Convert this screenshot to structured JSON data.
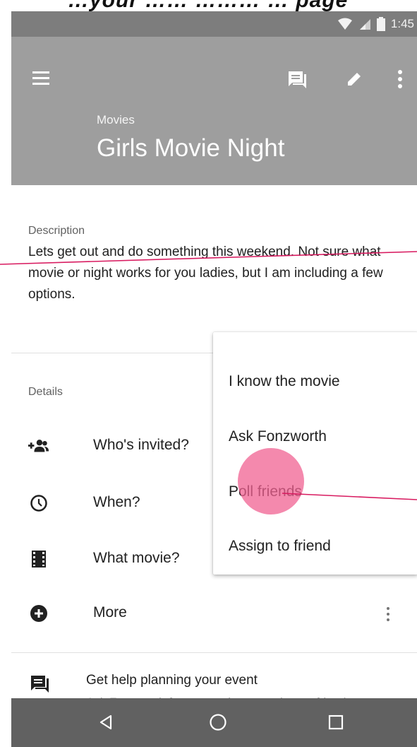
{
  "status_bar": {
    "time": "1:45"
  },
  "app_bar": {
    "category": "Movies",
    "title": "Girls Movie Night",
    "icons": [
      "menu-icon",
      "chat-icon",
      "edit-icon",
      "more-vert-icon"
    ]
  },
  "description": {
    "label": "Description",
    "text": "Lets get out and do something this weekend. Not sure what movie or night works for you ladies, but I am including a few options."
  },
  "details": {
    "label": "Details",
    "items": [
      {
        "label": "Who's invited?",
        "icon": "add-group-icon"
      },
      {
        "label": "When?",
        "icon": "clock-icon"
      },
      {
        "label": "What movie?",
        "icon": "film-icon"
      },
      {
        "label": "More",
        "icon": "add-circle-icon"
      }
    ]
  },
  "dropdown": {
    "items": [
      "I know the movie",
      "Ask Fonzworth",
      "Poll friends",
      "Assign to friend"
    ]
  },
  "help": {
    "title": "Get help planning your event",
    "subtitle": "Ask Fonzworth for suggestions or ask your friends"
  },
  "colors": {
    "status_bar": "#7d7d7d",
    "app_bar": "#9e9e9e",
    "nav_bar": "#616161",
    "annotation_line": "#d81b60",
    "touch_indicator": "#f06292"
  }
}
